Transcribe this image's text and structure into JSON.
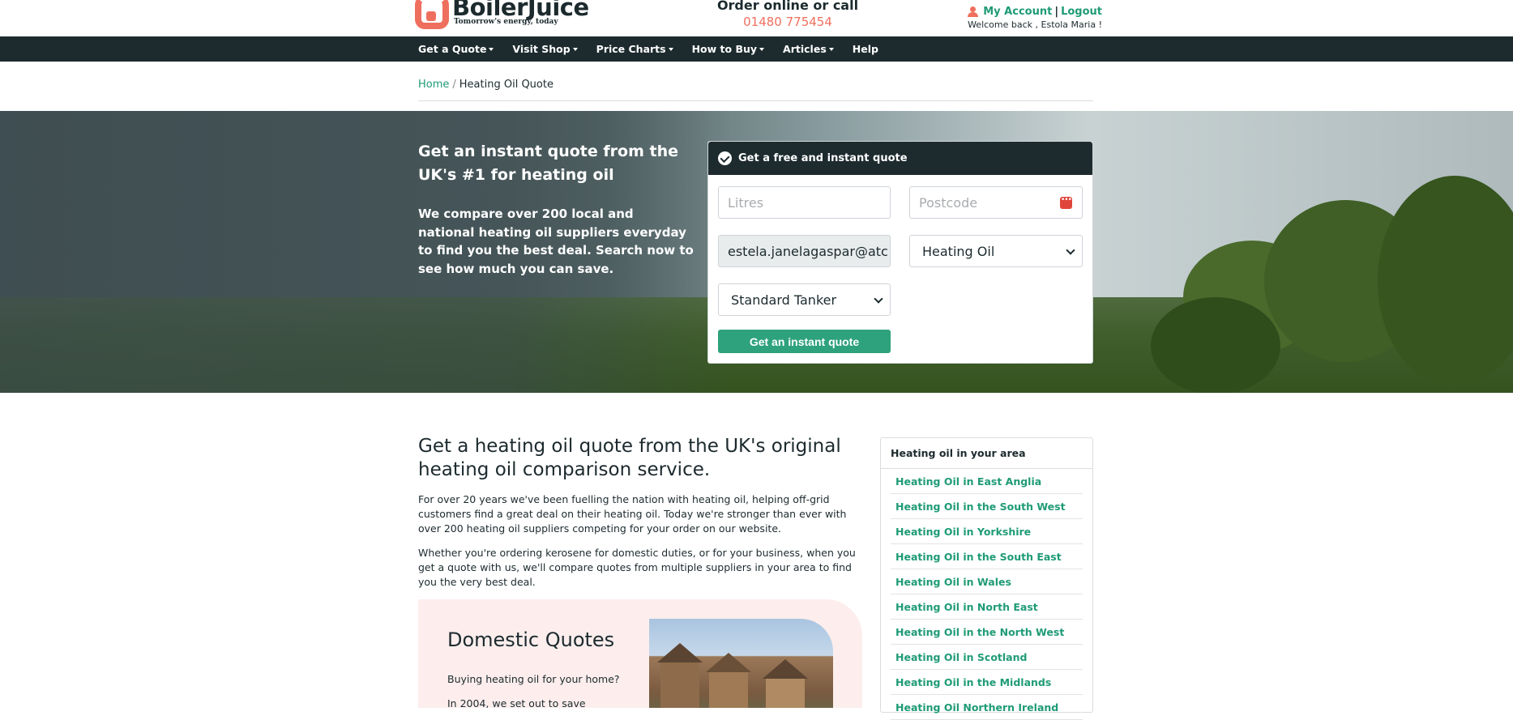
{
  "header": {
    "logo": {
      "name": "BoilerJuice",
      "tagline": "Tomorrow's energy, today"
    },
    "order": {
      "title": "Order online or call",
      "phone": "01480 775454"
    },
    "account": {
      "my_account": "My Account",
      "separator": "|",
      "logout": "Logout",
      "welcome": "Welcome back , Estola Maria !"
    }
  },
  "nav": {
    "items": [
      {
        "label": "Get a Quote",
        "dropdown": true
      },
      {
        "label": "Visit Shop",
        "dropdown": true
      },
      {
        "label": "Price Charts",
        "dropdown": true
      },
      {
        "label": "How to Buy",
        "dropdown": true
      },
      {
        "label": "Articles",
        "dropdown": true
      },
      {
        "label": "Help",
        "dropdown": false
      }
    ]
  },
  "breadcrumb": {
    "home": "Home",
    "separator": "/",
    "current": "Heating Oil Quote"
  },
  "hero": {
    "title": "Get an instant quote from the UK's #1 for heating oil",
    "body": "We compare over 200 local and national heating oil suppliers everyday to find you the best deal. Search now to see how much you can save."
  },
  "quote_form": {
    "header": "Get a free and instant quote",
    "litres": {
      "placeholder": "Litres",
      "value": ""
    },
    "postcode": {
      "placeholder": "Postcode",
      "value": ""
    },
    "email": {
      "value": "estela.janelagaspar@atc"
    },
    "fuel_type": {
      "selected": "Heating Oil"
    },
    "tanker": {
      "selected": "Standard Tanker"
    },
    "submit_label": "Get an instant quote"
  },
  "content": {
    "title": "Get a heating oil quote from the UK's original heating oil comparison service.",
    "para1": "For over 20 years we've been fuelling the nation with heating oil, helping off-grid customers find a great deal on their heating oil. Today we're stronger than ever with over 200 heating oil suppliers competing for your order on our website.",
    "para2": "Whether you're ordering kerosene for domestic duties, or for your business, when you get a quote with us, we'll compare quotes from multiple suppliers in your area to find you the very best deal.",
    "domestic": {
      "title": "Domestic Quotes",
      "line1": "Buying heating oil for your home?",
      "line2": "In 2004, we set out to save"
    }
  },
  "sidebar": {
    "title": "Heating oil in your area",
    "items": [
      "Heating Oil in East Anglia",
      "Heating Oil in the South West",
      "Heating Oil in Yorkshire",
      "Heating Oil in the South East",
      "Heating Oil in Wales",
      "Heating Oil in North East",
      "Heating Oil in the North West",
      "Heating Oil in Scotland",
      "Heating Oil in the Midlands",
      "Heating Oil Northern Ireland"
    ]
  },
  "colors": {
    "brand_coral": "#ef6f5e",
    "brand_green": "#2ea27c",
    "nav_dark": "#1d2b2f"
  }
}
